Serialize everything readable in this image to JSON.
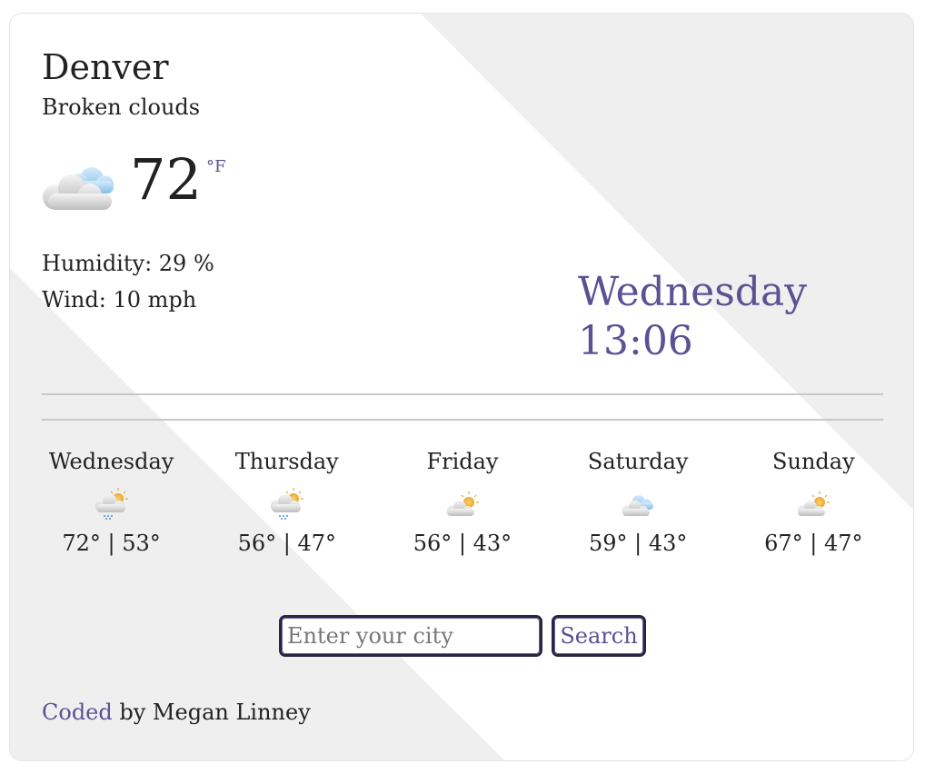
{
  "current": {
    "city": "Denver",
    "description": "Broken clouds",
    "temperature": "72",
    "unit": "°F",
    "humidity": "Humidity: 29 %",
    "wind": "Wind: 10 mph",
    "day": "Wednesday",
    "time": "13:06",
    "icon": "broken-clouds-icon"
  },
  "forecast": [
    {
      "day": "Wednesday",
      "temps": "72° | 53°",
      "icon": "sun-cloud-rain-icon"
    },
    {
      "day": "Thursday",
      "temps": "56° | 47°",
      "icon": "sun-cloud-rain-icon"
    },
    {
      "day": "Friday",
      "temps": "56° | 43°",
      "icon": "sun-cloud-icon"
    },
    {
      "day": "Saturday",
      "temps": "59° | 43°",
      "icon": "cloudy-icon"
    },
    {
      "day": "Sunday",
      "temps": "67° | 47°",
      "icon": "sun-cloud-icon"
    }
  ],
  "search": {
    "placeholder": "Enter your city",
    "value": "",
    "button_label": "Search"
  },
  "footer": {
    "link_text": "Coded",
    "text": " by Megan Linney"
  },
  "colors": {
    "accent": "#5a5294",
    "background_band": "#efefef",
    "divider": "#c9c9c9",
    "input_border": "#2b2540"
  }
}
